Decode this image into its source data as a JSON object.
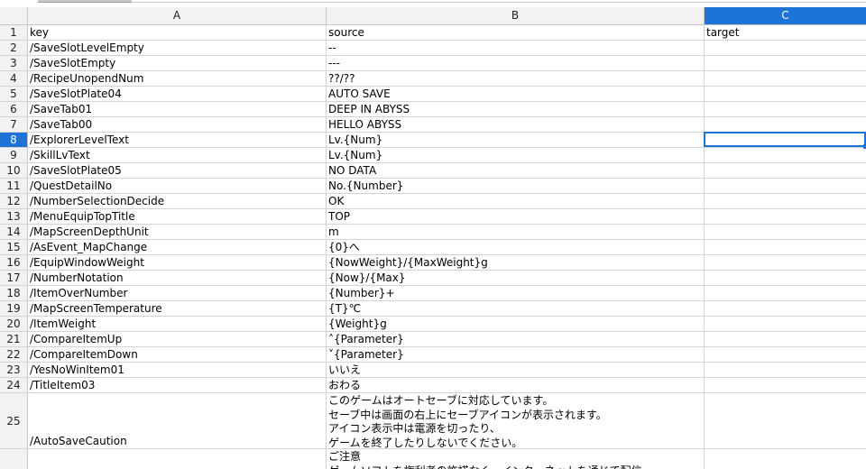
{
  "columns": [
    "A",
    "B",
    "C"
  ],
  "selected_column": "C",
  "selected_row": 8,
  "rows": [
    {
      "num": "1",
      "a": "key",
      "b": "source",
      "c": "target"
    },
    {
      "num": "2",
      "a": "/SaveSlotLevelEmpty",
      "b": "--",
      "c": ""
    },
    {
      "num": "3",
      "a": "/SaveSlotEmpty",
      "b": "---",
      "c": ""
    },
    {
      "num": "4",
      "a": "/RecipeUnopendNum",
      "b": "??/??",
      "c": ""
    },
    {
      "num": "5",
      "a": "/SaveSlotPlate04",
      "b": "AUTO SAVE",
      "c": ""
    },
    {
      "num": "6",
      "a": "/SaveTab01",
      "b": "DEEP IN ABYSS",
      "c": ""
    },
    {
      "num": "7",
      "a": "/SaveTab00",
      "b": "HELLO ABYSS",
      "c": ""
    },
    {
      "num": "8",
      "a": "/ExplorerLevelText",
      "b": "Lv.{Num}",
      "c": ""
    },
    {
      "num": "9",
      "a": "/SkillLvText",
      "b": "Lv.{Num}",
      "c": ""
    },
    {
      "num": "10",
      "a": "/SaveSlotPlate05",
      "b": "NO DATA",
      "c": ""
    },
    {
      "num": "11",
      "a": "/QuestDetailNo",
      "b": "No.{Number}",
      "c": ""
    },
    {
      "num": "12",
      "a": "/NumberSelectionDecide",
      "b": "OK",
      "c": ""
    },
    {
      "num": "13",
      "a": "/MenuEquipTopTitle",
      "b": "TOP",
      "c": ""
    },
    {
      "num": "14",
      "a": "/MapScreenDepthUnit",
      "b": "m",
      "c": ""
    },
    {
      "num": "15",
      "a": "/AsEvent_MapChange",
      "b": "{0}へ",
      "c": ""
    },
    {
      "num": "16",
      "a": "/EquipWindowWeight",
      "b": "{NowWeight}/{MaxWeight}g",
      "c": ""
    },
    {
      "num": "17",
      "a": "/NumberNotation",
      "b": "{Now}/{Max}",
      "c": ""
    },
    {
      "num": "18",
      "a": "/ItemOverNumber",
      "b": "{Number}+",
      "c": ""
    },
    {
      "num": "19",
      "a": "/MapScreenTemperature",
      "b": "{T}℃",
      "c": ""
    },
    {
      "num": "20",
      "a": "/ItemWeight",
      "b": "{Weight}g",
      "c": ""
    },
    {
      "num": "21",
      "a": "/CompareItemUp",
      "b": "˄{Parameter}",
      "c": ""
    },
    {
      "num": "22",
      "a": "/CompareItemDown",
      "b": "˅{Parameter}",
      "c": ""
    },
    {
      "num": "23",
      "a": "/YesNoWinItem01",
      "b": "いいえ",
      "c": ""
    },
    {
      "num": "24",
      "a": "/TitleItem03",
      "b": "おわる",
      "c": ""
    },
    {
      "num": "25",
      "a": "/AutoSaveCaution",
      "b": "このゲームはオートセーブに対応しています。\nセーブ中は画面の右上にセーブアイコンが表示されます。\nアイコン表示中は電源を切ったり、\nゲームを終了したりしないでください。",
      "c": ""
    },
    {
      "num": "",
      "a": "",
      "b": "ご注意\nゲームソフトを権利者の許諾なく、インターネットを通じて配信",
      "c": ""
    }
  ]
}
